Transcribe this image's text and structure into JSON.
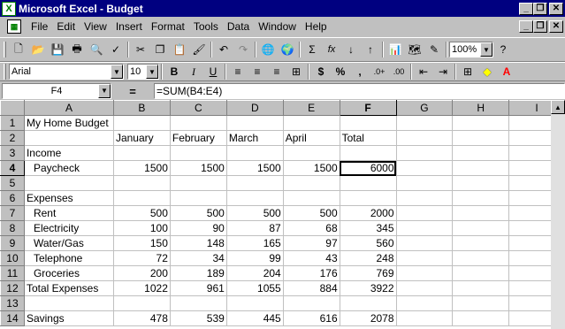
{
  "window": {
    "title": "Microsoft Excel - Budget",
    "app_icon": "X"
  },
  "menu": {
    "items": [
      "File",
      "Edit",
      "View",
      "Insert",
      "Format",
      "Tools",
      "Data",
      "Window",
      "Help"
    ]
  },
  "toolbar": {
    "zoom": "100%",
    "font": "Arial",
    "size": "10",
    "autosum": "Σ",
    "fx": "fx",
    "currency": "$",
    "percent": "%",
    "comma": ",",
    "bold": "B",
    "italic": "I",
    "underline": "U"
  },
  "formula_bar": {
    "name_box": "F4",
    "equals": "=",
    "formula": "=SUM(B4:E4)"
  },
  "columns": [
    "A",
    "B",
    "C",
    "D",
    "E",
    "F",
    "G",
    "H",
    "I"
  ],
  "rows": [
    {
      "n": "1",
      "a": "My Home Budget",
      "b": "",
      "c": "",
      "d": "",
      "e": "",
      "f": ""
    },
    {
      "n": "2",
      "a": "",
      "b": "January",
      "c": "February",
      "d": "March",
      "e": "April",
      "f": "Total"
    },
    {
      "n": "3",
      "a": "Income",
      "b": "",
      "c": "",
      "d": "",
      "e": "",
      "f": ""
    },
    {
      "n": "4",
      "a": "  Paycheck",
      "b": "1500",
      "c": "1500",
      "d": "1500",
      "e": "1500",
      "f": "6000"
    },
    {
      "n": "5",
      "a": "",
      "b": "",
      "c": "",
      "d": "",
      "e": "",
      "f": ""
    },
    {
      "n": "6",
      "a": "Expenses",
      "b": "",
      "c": "",
      "d": "",
      "e": "",
      "f": ""
    },
    {
      "n": "7",
      "a": "  Rent",
      "b": "500",
      "c": "500",
      "d": "500",
      "e": "500",
      "f": "2000"
    },
    {
      "n": "8",
      "a": "  Electricity",
      "b": "100",
      "c": "90",
      "d": "87",
      "e": "68",
      "f": "345"
    },
    {
      "n": "9",
      "a": "  Water/Gas",
      "b": "150",
      "c": "148",
      "d": "165",
      "e": "97",
      "f": "560"
    },
    {
      "n": "10",
      "a": "  Telephone",
      "b": "72",
      "c": "34",
      "d": "99",
      "e": "43",
      "f": "248"
    },
    {
      "n": "11",
      "a": "  Groceries",
      "b": "200",
      "c": "189",
      "d": "204",
      "e": "176",
      "f": "769"
    },
    {
      "n": "12",
      "a": "Total Expenses",
      "b": "1022",
      "c": "961",
      "d": "1055",
      "e": "884",
      "f": "3922"
    },
    {
      "n": "13",
      "a": "",
      "b": "",
      "c": "",
      "d": "",
      "e": "",
      "f": ""
    },
    {
      "n": "14",
      "a": "Savings",
      "b": "478",
      "c": "539",
      "d": "445",
      "e": "616",
      "f": "2078"
    }
  ]
}
